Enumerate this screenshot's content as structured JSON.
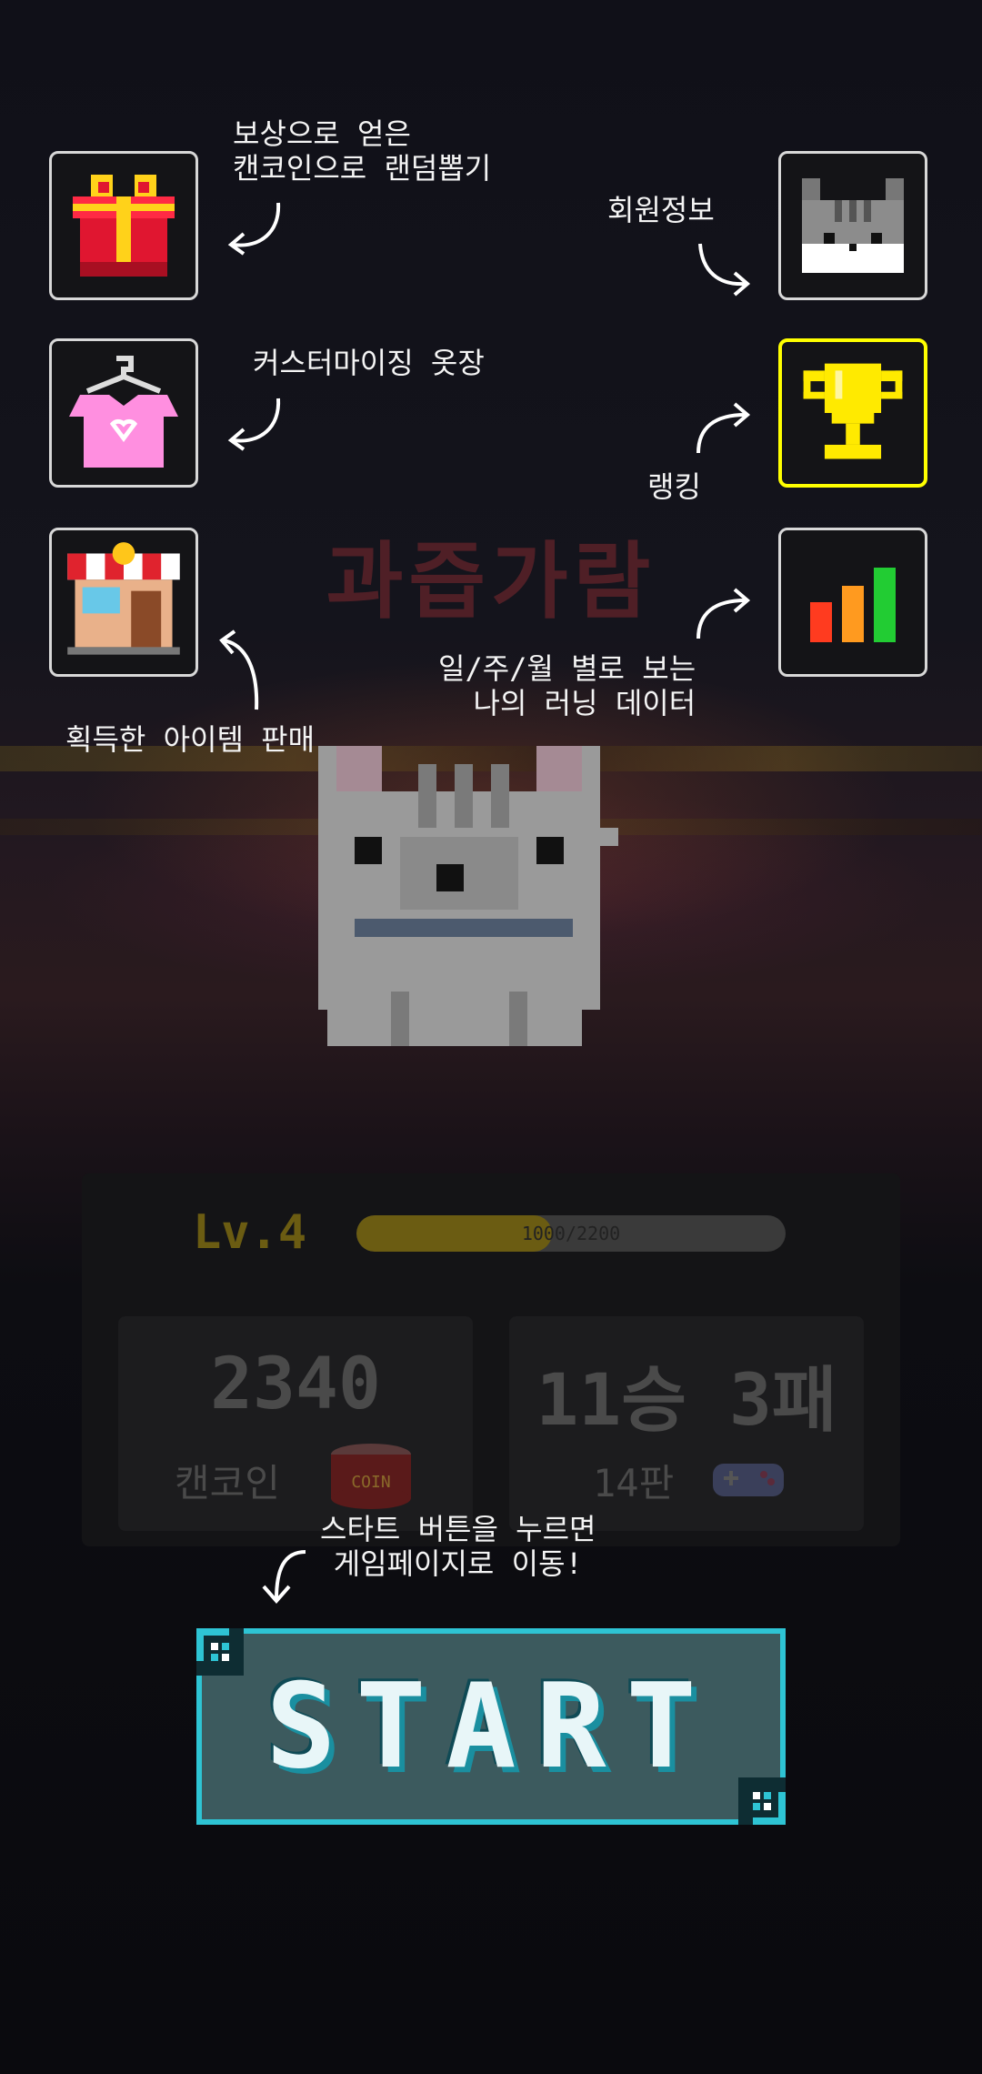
{
  "overlay_title": "과즙가람",
  "hints": {
    "gacha": "보상으로 얻은\n캔코인으로 랜덤뽑기",
    "profile": "회원정보",
    "closet": "커스터마이징 옷장",
    "ranking": "랭킹",
    "shop": "획득한 아이템 판매",
    "stats": "일/주/월 별로 보는\n나의 러닝 데이터",
    "start": "스타트 버튼을 누르면\n게임페이지로 이동!"
  },
  "icons": {
    "gacha": "gift-box-icon",
    "profile": "cat-face-icon",
    "closet": "shirt-hanger-icon",
    "ranking": "trophy-icon",
    "shop": "shop-stall-icon",
    "stats": "bar-chart-icon"
  },
  "player": {
    "level": "Lv.4",
    "xp_text": "1000/2200",
    "xp_progress": 0.4545
  },
  "coins": {
    "value": "2340",
    "label": "캔코인",
    "icon": "coin-can-icon",
    "can_text": "COIN"
  },
  "record": {
    "wins_losses": "11승 3패",
    "games": "14판",
    "icon": "gamepad-icon"
  },
  "start_button": {
    "label": "START"
  },
  "colors": {
    "accent": "#2ec4d4",
    "trophy_border": "#ffff00",
    "bar_red": "#ff3b1f",
    "bar_orange": "#ff9a1f",
    "bar_green": "#22cc33"
  }
}
